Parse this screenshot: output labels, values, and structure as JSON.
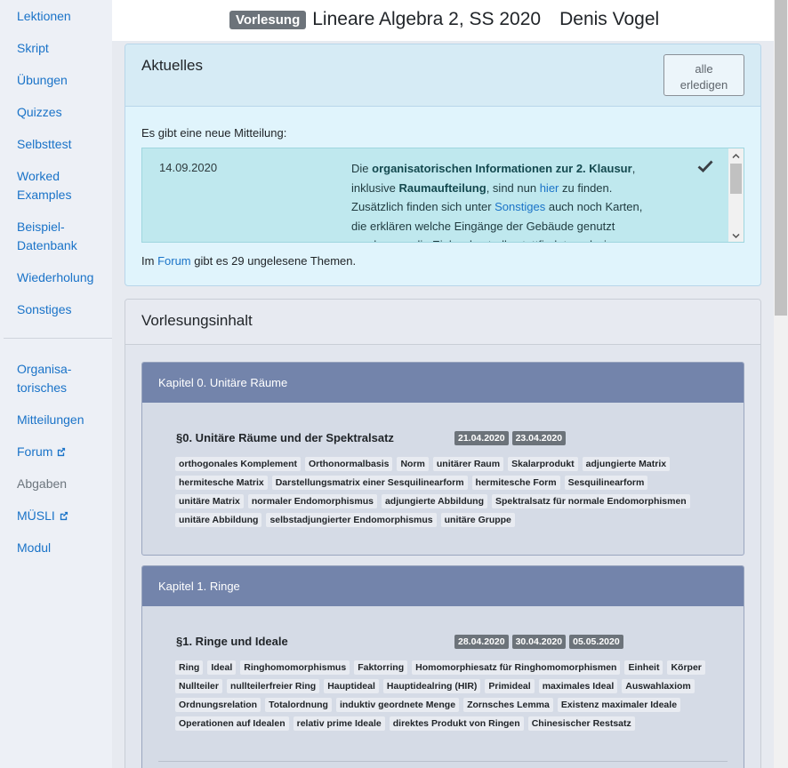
{
  "sidebar": {
    "items": [
      {
        "label": "Lektionen"
      },
      {
        "label": "Skript"
      },
      {
        "label": "Übungen"
      },
      {
        "label": "Quizzes"
      },
      {
        "label": "Selbsttest"
      },
      {
        "label": "Worked\nExamples"
      },
      {
        "label": "Beispiel-\nDatenbank"
      },
      {
        "label": "Wiederholung"
      },
      {
        "label": "Sonstiges"
      }
    ],
    "items2": [
      {
        "label": "Organisa-\ntorisches"
      },
      {
        "label": "Mitteilungen"
      },
      {
        "label": "Forum"
      },
      {
        "label": "Abgaben"
      },
      {
        "label": "MÜSLI"
      },
      {
        "label": "Modul"
      }
    ]
  },
  "header": {
    "badge": "Vorlesung",
    "title": "Lineare Algebra 2, SS 2020",
    "author": "Denis Vogel"
  },
  "news": {
    "title": "Aktuelles",
    "dismiss_all": "alle\nerledigen",
    "intro": "Es gibt eine neue Mitteilung:",
    "message": {
      "date": "14.09.2020",
      "p1": "Die ",
      "b1": "organisatorischen Informationen zur 2. Klausur",
      "p2": ", inklusive ",
      "b2": "Raumaufteilung",
      "p3": ", sind nun ",
      "link1": "hier",
      "p4": " zu finden. Zusätzlich finden sich unter ",
      "link2": "Sonstiges",
      "p5": " auch noch Karten, die erklären welche Eingänge der Gebäude genutzt werden, wo die Einlasskontrolle stattfindet, und wie man"
    },
    "forum_pre": "Im ",
    "forum_link": "Forum",
    "forum_post": " gibt es 29 ungelesene Themen."
  },
  "content": {
    "title": "Vorlesungsinhalt",
    "chapters": [
      {
        "title": "Kapitel 0. Unitäre Räume",
        "section": "§0. Unitäre Räume und der Spektralsatz",
        "dates": [
          "21.04.2020",
          "23.04.2020"
        ],
        "tags": [
          "orthogonales Komplement",
          "Orthonormalbasis",
          "Norm",
          "unitärer Raum",
          "Skalarprodukt",
          "adjungierte Matrix",
          "hermitesche Matrix",
          "Darstellungsmatrix einer Sesquilinearform",
          "hermitesche Form",
          "Sesquilinearform",
          "unitäre Matrix",
          "normaler Endomorphismus",
          "adjungierte Abbildung",
          "Spektralsatz für normale Endomorphismen",
          "unitäre Abbildung",
          "selbstadjungierter Endomorphismus",
          "unitäre Gruppe"
        ]
      },
      {
        "title": "Kapitel 1. Ringe",
        "section": "§1. Ringe und Ideale",
        "dates": [
          "28.04.2020",
          "30.04.2020",
          "05.05.2020"
        ],
        "tags": [
          "Ring",
          "Ideal",
          "Ringhomomorphismus",
          "Faktorring",
          "Homomorphiesatz für Ringhomomorphismen",
          "Einheit",
          "Körper",
          "Nullteiler",
          "nullteilerfreier Ring",
          "Hauptideal",
          "Hauptidealring (HIR)",
          "Primideal",
          "maximales Ideal",
          "Auswahlaxiom",
          "Ordnungsrelation",
          "Totalordnung",
          "induktiv geordnete Menge",
          "Zornsches Lemma",
          "Existenz maximaler Ideale",
          "Operationen auf Idealen",
          "relativ prime Ideale",
          "direktes Produkt von Ringen",
          "Chinesischer Restsatz"
        ]
      }
    ]
  },
  "colors": {
    "link": "#1a73c8",
    "chapter_header": "#7384ab",
    "news_bg": "#e0f4fc",
    "message_bg": "#bfe8ee",
    "badge": "#6c737a"
  }
}
